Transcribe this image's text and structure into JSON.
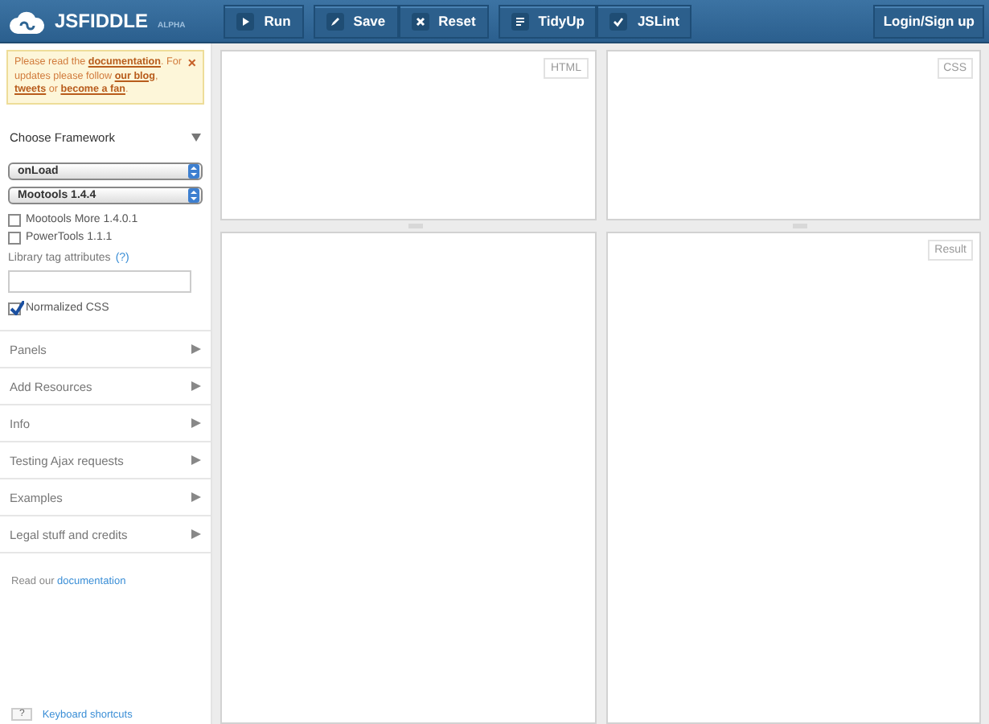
{
  "header": {
    "logo": "JSFIDDLE",
    "tag": "ALPHA",
    "button_groups": [
      [
        {
          "label": "Run"
        }
      ],
      [
        {
          "label": "Save"
        },
        {
          "label": "Reset"
        }
      ],
      [
        {
          "label": "TidyUp"
        },
        {
          "label": "JSLint"
        }
      ]
    ],
    "login": "Login/Sign up"
  },
  "notice": {
    "close": "×",
    "text": "Please read the **documentation**. For updates please follow **our blog**, **tweets** or **become a fan**."
  },
  "sidebar": {
    "framework": {
      "title": "Choose Framework",
      "expanded": true,
      "selects": [
        {
          "value": "onLoad"
        },
        {
          "value": "Mootools 1.4.4"
        }
      ],
      "checkboxes": [
        {
          "label": "Mootools More 1.4.0.1",
          "checked": false
        },
        {
          "label": "PowerTools 1.1.1",
          "checked": false
        }
      ],
      "attr_label": "Library tag attributes",
      "attr_help": "(?)",
      "normalized": {
        "label": "Normalized CSS",
        "checked": true
      }
    },
    "sections": [
      {
        "title": "Panels",
        "expanded": false
      },
      {
        "title": "Add Resources",
        "expanded": false
      },
      {
        "title": "Info",
        "expanded": false
      },
      {
        "title": "Testing Ajax requests",
        "expanded": false
      },
      {
        "title": "Examples",
        "expanded": false
      },
      {
        "title": "Legal stuff and credits",
        "expanded": false
      }
    ],
    "read_text": "Read our ",
    "read_link": "documentation",
    "shortcut_key": "?",
    "shortcut_link": "Keyboard shortcuts"
  },
  "panels": {
    "html": "HTML",
    "css": "CSS",
    "result": "Result"
  }
}
